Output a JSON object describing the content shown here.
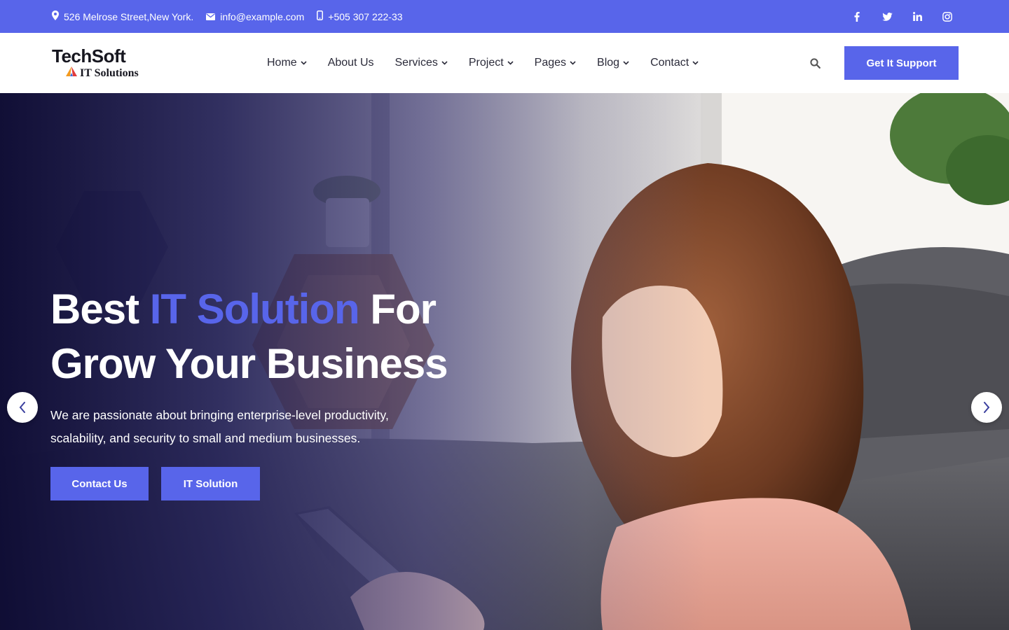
{
  "topbar": {
    "address": "526 Melrose Street,New York.",
    "email": "info@example.com",
    "phone": "+505 307 222-33",
    "social_icons": [
      "facebook-icon",
      "twitter-icon",
      "linkedin-icon",
      "instagram-icon"
    ]
  },
  "logo": {
    "name": "TechSoft",
    "tagline": "IT Solutions"
  },
  "nav": {
    "items": [
      {
        "label": "Home",
        "has_dropdown": true
      },
      {
        "label": "About Us",
        "has_dropdown": false
      },
      {
        "label": "Services",
        "has_dropdown": true
      },
      {
        "label": "Project",
        "has_dropdown": true
      },
      {
        "label": "Pages",
        "has_dropdown": true
      },
      {
        "label": "Blog",
        "has_dropdown": true
      },
      {
        "label": "Contact",
        "has_dropdown": true
      }
    ],
    "support_label": "Get It Support"
  },
  "hero": {
    "title_part1": "Best ",
    "title_accent": "IT Solution",
    "title_part2": " For",
    "title_line2": "Grow Your Business",
    "description": "We are passionate about bringing enterprise-level productivity, scalability, and security to small and medium businesses.",
    "primary_button": "Contact Us",
    "secondary_button": "IT Solution"
  },
  "colors": {
    "accent": "#5865ea",
    "topbar_bg": "#5865ea",
    "text_dark": "#2b2b3a"
  }
}
